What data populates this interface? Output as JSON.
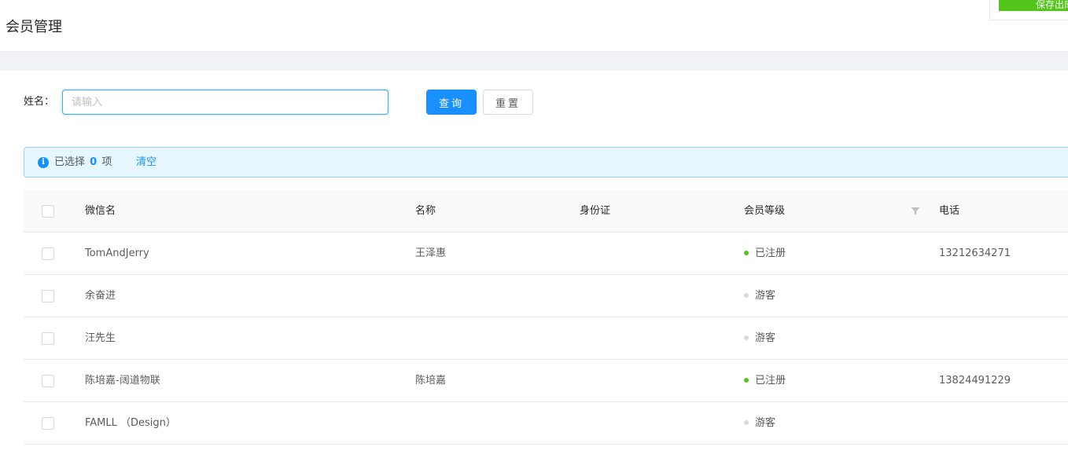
{
  "page": {
    "title": "会员管理"
  },
  "corner": {
    "button_label": "保存出库"
  },
  "search": {
    "name_label": "姓名：",
    "name_placeholder": "请输入",
    "query_label": "查询",
    "reset_label": "重置"
  },
  "alert": {
    "prefix": "已选择",
    "count": "0",
    "suffix": "项",
    "clear_label": "清空"
  },
  "table": {
    "columns": [
      "微信名",
      "名称",
      "身份证",
      "会员等级",
      "电话"
    ],
    "rows": [
      {
        "wechat": "TomAndJerry",
        "name": "王泽惠",
        "id_card": "",
        "level": "已注册",
        "level_status": "registered",
        "phone": "13212634271"
      },
      {
        "wechat": "余奋进",
        "name": "",
        "id_card": "",
        "level": "游客",
        "level_status": "guest",
        "phone": ""
      },
      {
        "wechat": "汪先生",
        "name": "",
        "id_card": "",
        "level": "游客",
        "level_status": "guest",
        "phone": ""
      },
      {
        "wechat": "陈培嘉-阔道物联",
        "name": "陈培嘉",
        "id_card": "",
        "level": "已注册",
        "level_status": "registered",
        "phone": "13824491229"
      },
      {
        "wechat": "FAMLL （Design）",
        "name": "",
        "id_card": "",
        "level": "游客",
        "level_status": "guest",
        "phone": ""
      }
    ]
  },
  "colors": {
    "primary": "#1890ff",
    "registered_dot": "#52c41a",
    "guest_dot": "#d9d9d9",
    "corner_button": "#52c41a"
  },
  "icons": {
    "info": "info-circle-icon",
    "filter": "filter-icon",
    "checkbox": "checkbox-icon"
  }
}
